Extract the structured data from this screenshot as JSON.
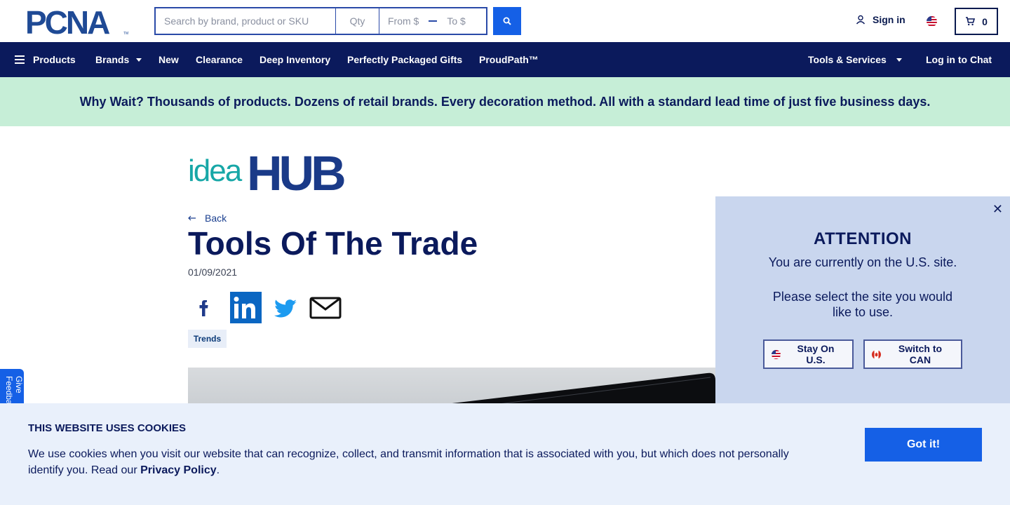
{
  "header": {
    "logo_text": "PCNA",
    "search": {
      "placeholder": "Search by brand, product or SKU",
      "qty_placeholder": "Qty",
      "from_placeholder": "From $",
      "to_placeholder": "To $"
    },
    "signin_label": "Sign in",
    "cart_count": "0"
  },
  "nav": {
    "products": "Products",
    "brands": "Brands",
    "new": "New",
    "clearance": "Clearance",
    "deep_inventory": "Deep Inventory",
    "perfectly_packaged": "Perfectly Packaged Gifts",
    "proudpath": "ProudPath™",
    "tools_services": "Tools & Services",
    "chat": "Log in to Chat"
  },
  "banner": {
    "text": "Why Wait? Thousands of products. Dozens of retail brands. Every decoration method. All with a standard lead time of just five business days."
  },
  "article": {
    "brand_logo": "ideaHUB",
    "back_label": "Back",
    "title": "Tools Of The Trade",
    "date": "01/09/2021",
    "tag": "Trends"
  },
  "feedback_tab": "Give Feedback",
  "site_modal": {
    "heading": "ATTENTION",
    "line1": "You are currently on the U.S. site.",
    "line2": "Please select the site you would like to use.",
    "stay_label": "Stay On U.S.",
    "switch_label": "Switch to CAN"
  },
  "cookies": {
    "heading": "THIS WEBSITE USES COOKIES",
    "text": "We use cookies when you visit our website that can recognize, collect, and transmit information that is associated with you, but which does not personally identify you. Read our",
    "link": "Privacy Policy",
    "period": ".",
    "button": "Got it!"
  },
  "colors": {
    "navy": "#0b1a5c",
    "accent_blue": "#1560e6",
    "banner_green": "#c6eed7",
    "modal_bg": "#c9d6ee",
    "cookie_bg": "#e9f0fb"
  }
}
